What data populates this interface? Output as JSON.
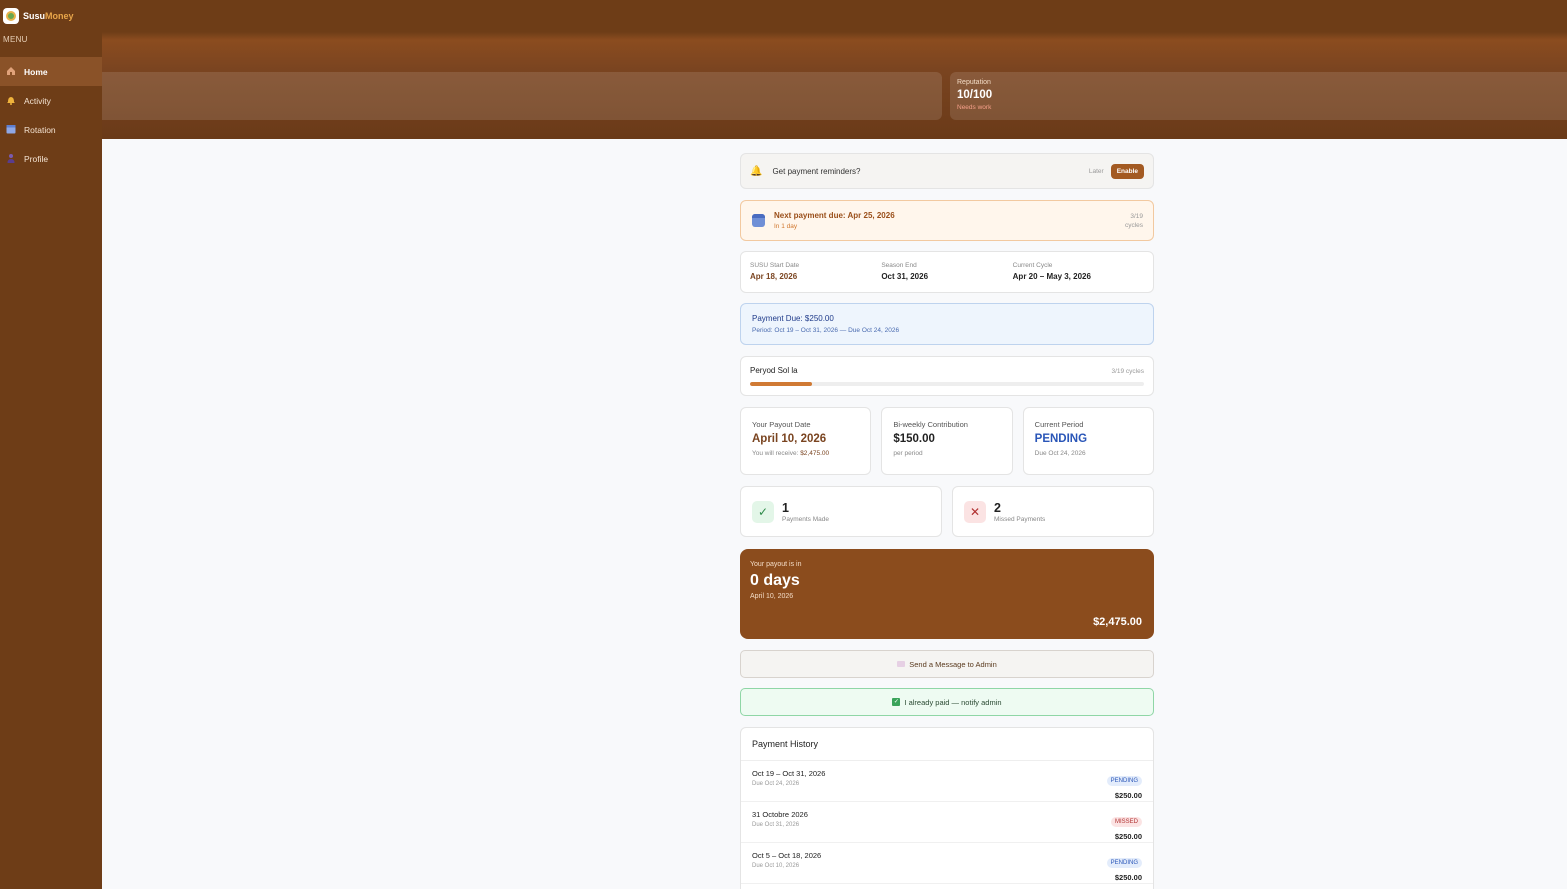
{
  "brand": {
    "name_main": "Susu",
    "name_accent": "Money"
  },
  "sidebar": {
    "menu_label": "MENU",
    "items": [
      {
        "label": "Home",
        "icon": "home-icon",
        "active": true
      },
      {
        "label": "Activity",
        "icon": "bell-icon",
        "active": false
      },
      {
        "label": "Rotation",
        "icon": "calendar-icon",
        "active": false
      },
      {
        "label": "Profile",
        "icon": "person-icon",
        "active": false
      }
    ]
  },
  "header": {
    "reputation": {
      "label": "Reputation",
      "value": "10/100",
      "note": "Needs work"
    }
  },
  "reminder": {
    "text": "Get payment reminders?",
    "later": "Later",
    "enable": "Enable"
  },
  "next_due": {
    "title": "Next payment due: Apr 25, 2026",
    "sub": "In 1 day",
    "cycles_count": "3/19",
    "cycles_label": "cycles"
  },
  "dates": {
    "start": {
      "label": "SUSU Start Date",
      "value": "Apr 18, 2026"
    },
    "end": {
      "label": "Season End",
      "value": "Oct 31, 2026"
    },
    "cycle": {
      "label": "Current Cycle",
      "value": "Apr 20 – May 3, 2026"
    }
  },
  "payment_due": {
    "title": "Payment Due: $250.00",
    "sub": "Period: Oct 19 – Oct 31, 2026 — Due Oct 24, 2026"
  },
  "progress": {
    "label": "Peryod Sol la",
    "cycles": "3/19 cycles",
    "fraction": 0.158
  },
  "stats": {
    "payout": {
      "label": "Your Payout Date",
      "value": "April 10, 2026",
      "sub_prefix": "You will receive:",
      "sub_amount": "$2,475.00"
    },
    "contribution": {
      "label": "Bi-weekly Contribution",
      "value": "$150.00",
      "sub": "per period"
    },
    "period": {
      "label": "Current Period",
      "value": "PENDING",
      "sub": "Due Oct 24, 2026"
    }
  },
  "counts": {
    "made": {
      "num": "1",
      "label": "Payments Made"
    },
    "missed": {
      "num": "2",
      "label": "Missed Payments"
    }
  },
  "payout_card": {
    "label": "Your payout is in",
    "big": "0 days",
    "date": "April 10, 2026",
    "amount": "$2,475.00"
  },
  "actions": {
    "message": "Send a Message to Admin",
    "paid": "I already paid — notify admin"
  },
  "history": {
    "title": "Payment History",
    "rows": [
      {
        "period": "Oct 19 – Oct 31, 2026",
        "due": "Due Oct 24, 2026",
        "status": "PENDING",
        "amount": "$250.00"
      },
      {
        "period": "31 Octobre 2026",
        "due": "Due Oct 31, 2026",
        "status": "MISSED",
        "amount": "$250.00"
      },
      {
        "period": "Oct 5 – Oct 18, 2026",
        "due": "Due Oct 10, 2026",
        "status": "PENDING",
        "amount": "$250.00"
      }
    ]
  }
}
